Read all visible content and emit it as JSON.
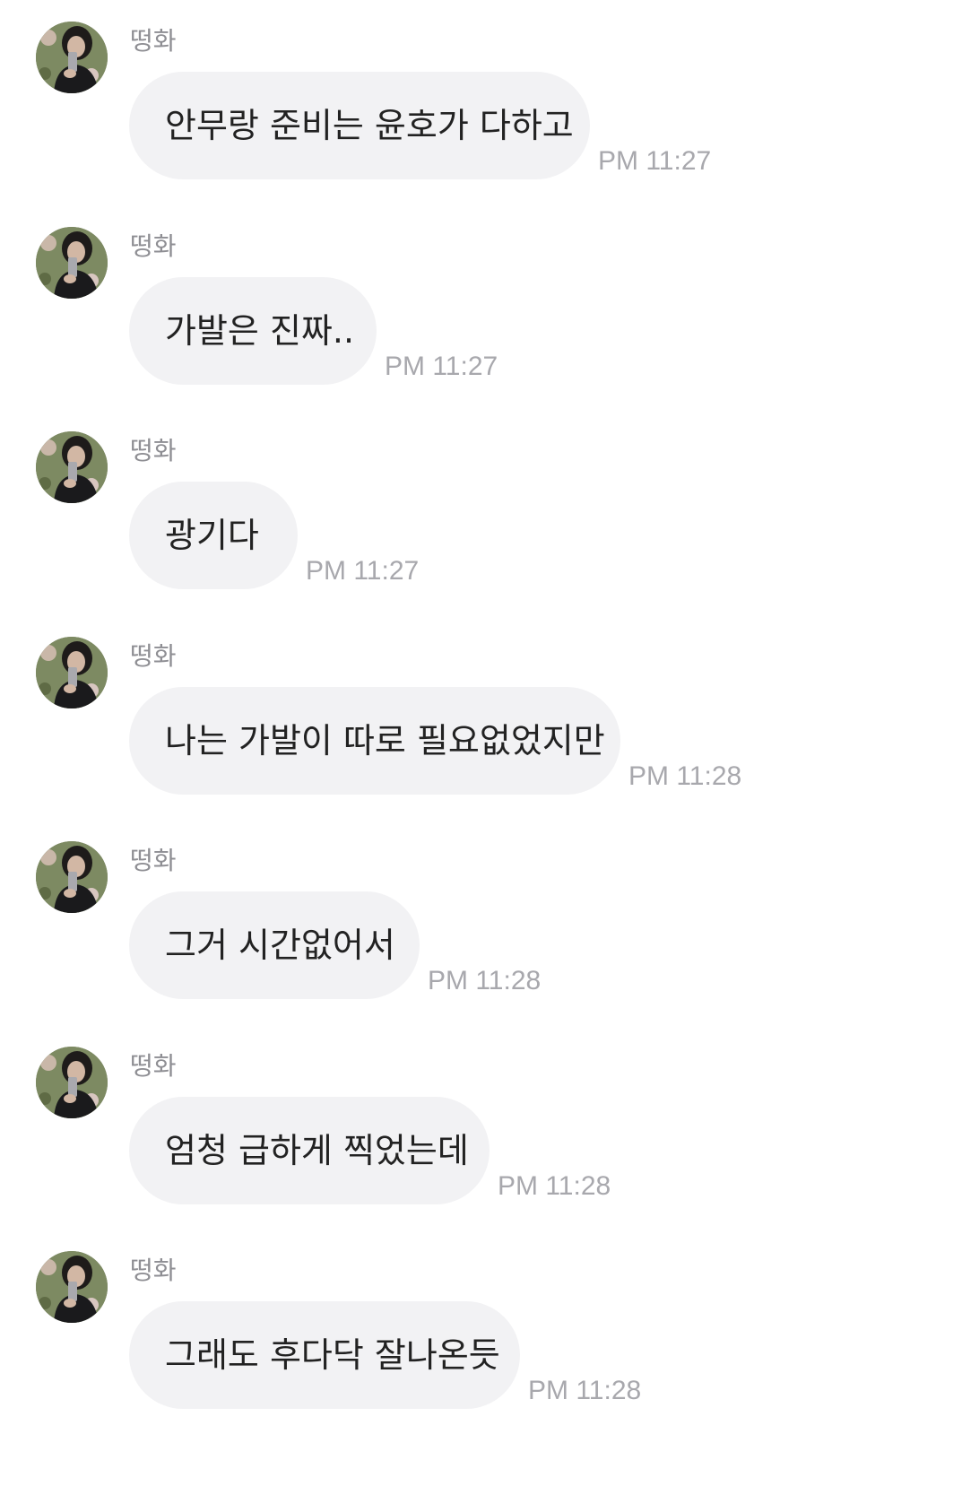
{
  "messages": [
    {
      "sender": "떵화",
      "text": "안무랑 준비는 윤호가 다하고",
      "time": "PM 11:27"
    },
    {
      "sender": "떵화",
      "text": "가발은 진짜..",
      "time": "PM 11:27"
    },
    {
      "sender": "떵화",
      "text": "광기다",
      "time": "PM 11:27"
    },
    {
      "sender": "떵화",
      "text": "나는 가발이 따로 필요없었지만",
      "time": "PM 11:28"
    },
    {
      "sender": "떵화",
      "text": "그거 시간없어서",
      "time": "PM 11:28"
    },
    {
      "sender": "떵화",
      "text": "엄청 급하게 찍었는데",
      "time": "PM 11:28"
    },
    {
      "sender": "떵화",
      "text": "그래도 후다닥 잘나온듯",
      "time": "PM 11:28"
    }
  ],
  "colors": {
    "bubble": "#f2f2f4",
    "text": "#222222",
    "sender": "#8e8e93",
    "time": "#a8a8ad"
  },
  "icons": {
    "avatar": "profile-photo-avatar"
  }
}
